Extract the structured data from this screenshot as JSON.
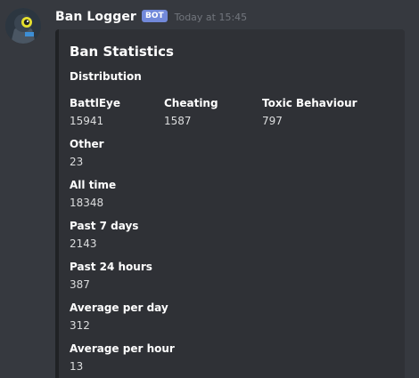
{
  "author": {
    "name": "Ban Logger",
    "tag": "BOT",
    "timestamp": "Today at 15:45",
    "avatar_icon": "eye-logo-icon"
  },
  "embed": {
    "title": "Ban Statistics",
    "description": "Distribution",
    "accent_color": "#202225",
    "fields": [
      {
        "name": "BattlEye",
        "value": "15941"
      },
      {
        "name": "Cheating",
        "value": "1587"
      },
      {
        "name": "Toxic Behaviour",
        "value": "797"
      },
      {
        "name": "Other",
        "value": "23"
      },
      {
        "name": "All time",
        "value": "18348"
      },
      {
        "name": "Past 7 days",
        "value": "2143"
      },
      {
        "name": "Past 24 hours",
        "value": "387"
      },
      {
        "name": "Average per day",
        "value": "312"
      },
      {
        "name": "Average per hour",
        "value": "13"
      }
    ]
  },
  "colors": {
    "background": "#36393f",
    "embed_background": "#2f3136",
    "bot_tag": "#7289da",
    "timestamp": "#72767d"
  }
}
